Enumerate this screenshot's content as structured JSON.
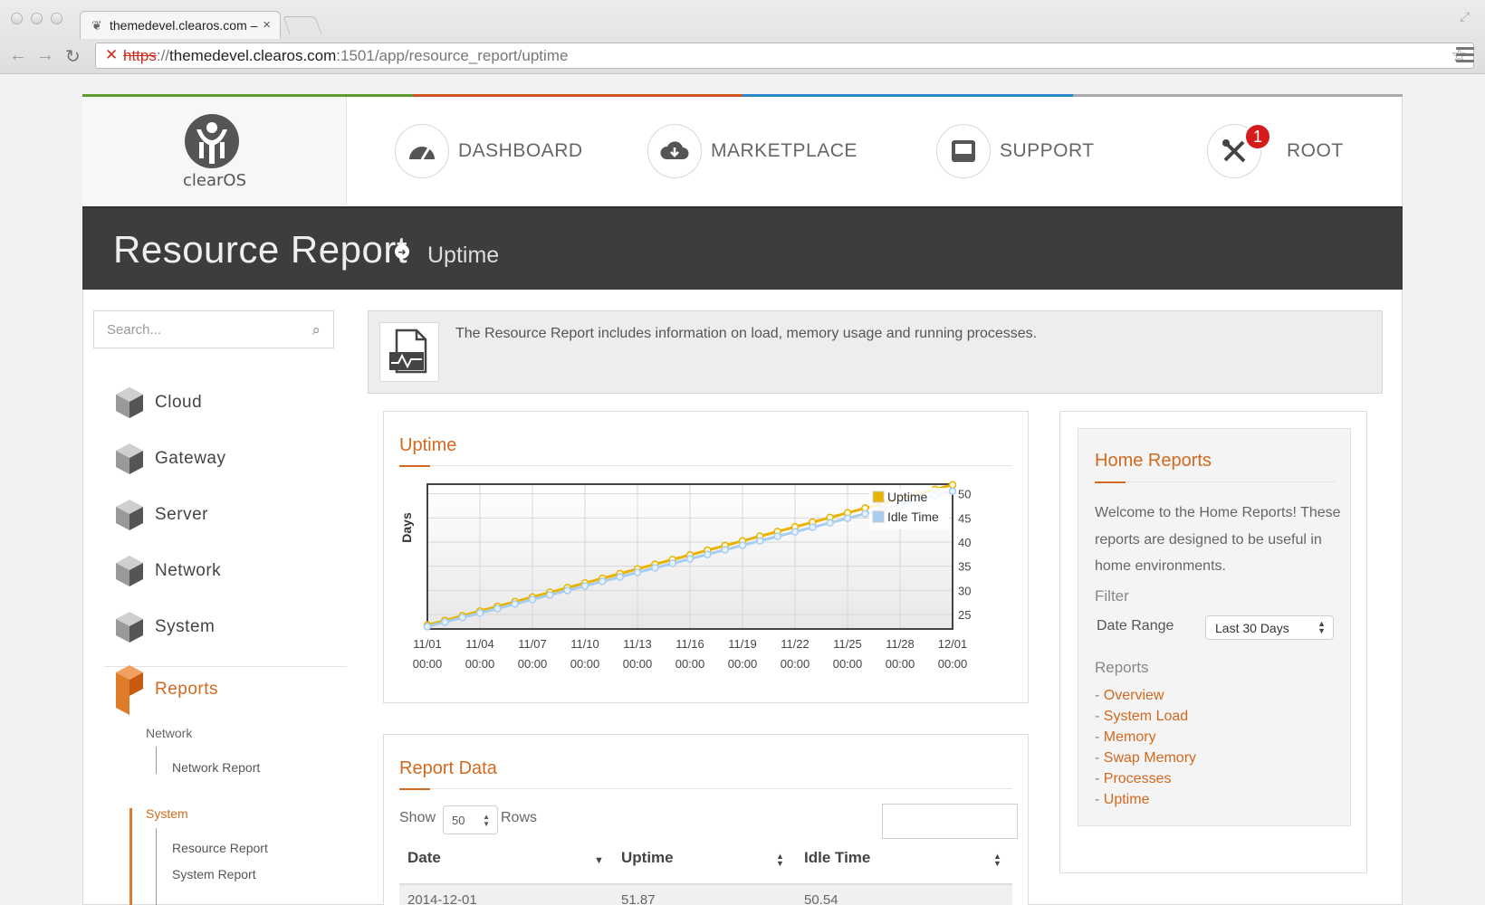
{
  "browser": {
    "tab_title": "themedevel.clearos.com –",
    "tab_close": "×",
    "url_scheme": "https",
    "url_sep": "://",
    "url_host": "themedevel.clearos.com",
    "url_path": ":1501/app/resource_report/uptime"
  },
  "brand": {
    "logo_text": "clearOS"
  },
  "topnav": [
    {
      "label": "DASHBOARD"
    },
    {
      "label": "MARKETPLACE"
    },
    {
      "label": "SUPPORT"
    },
    {
      "label": "ROOT",
      "badge": "1"
    }
  ],
  "colors": {
    "stripe": [
      "#5d9a2f",
      "#d2541e",
      "#2a86c9",
      "#aaaaaa"
    ],
    "accent": "#d2691e",
    "uptime": "#e8b400",
    "idle": "#a7cdf0"
  },
  "header": {
    "title": "Resource Report",
    "subtitle": "Uptime"
  },
  "sidebar": {
    "search_placeholder": "Search...",
    "items": [
      {
        "label": "Cloud",
        "letter": "C"
      },
      {
        "label": "Gateway",
        "letter": "G"
      },
      {
        "label": "Server",
        "letter": "S"
      },
      {
        "label": "Network",
        "letter": "N"
      },
      {
        "label": "System",
        "letter": "+"
      },
      {
        "label": "Reports",
        "letter": "R"
      }
    ],
    "reports_sub": {
      "group1": "Network",
      "group1_link": "Network Report",
      "group2": "System",
      "group2_links": [
        "Resource Report",
        "System Report"
      ]
    }
  },
  "info": {
    "text": "The Resource Report includes information on load, memory usage and running processes."
  },
  "uptime_panel": {
    "title": "Uptime"
  },
  "chart_data": {
    "type": "line",
    "ylabel": "Days",
    "x_ticks": [
      "11/01",
      "11/04",
      "11/07",
      "11/10",
      "11/13",
      "11/16",
      "11/19",
      "11/22",
      "11/25",
      "11/28",
      "12/01"
    ],
    "x_ticks_time": "00:00",
    "y_ticks": [
      25,
      30,
      35,
      40,
      45,
      50
    ],
    "ylim": [
      22,
      52
    ],
    "xlim": [
      0,
      30
    ],
    "legend": "top-right",
    "series": [
      {
        "name": "Uptime",
        "start": 22.8,
        "end": 51.87
      },
      {
        "name": "Idle Time",
        "start": 22.5,
        "end": 50.54
      }
    ]
  },
  "report_panel": {
    "title": "Report Data",
    "show": "Show",
    "rows_value": "50",
    "rows": "Rows",
    "columns": [
      "Date",
      "Uptime",
      "Idle Time"
    ],
    "first_row": [
      "2014-12-01",
      "51.87",
      "50.54"
    ]
  },
  "home_reports": {
    "title": "Home Reports",
    "description": "Welcome to the Home Reports! These reports are designed to be useful in home environments.",
    "filter_label": "Filter",
    "date_range_label": "Date Range",
    "date_range_value": "Last 30 Days",
    "reports_label": "Reports",
    "links": [
      "Overview",
      "System Load",
      "Memory",
      "Swap Memory",
      "Processes",
      "Uptime"
    ]
  }
}
